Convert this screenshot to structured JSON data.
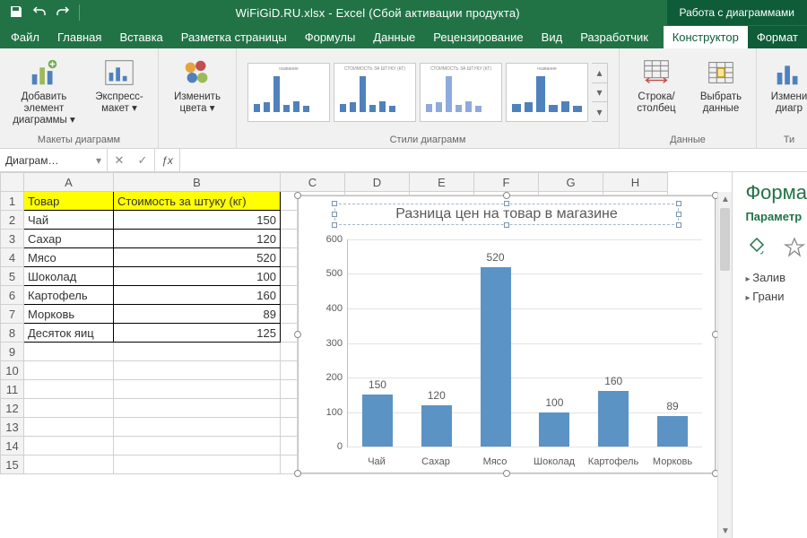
{
  "app": {
    "title": "WiFiGiD.RU.xlsx - Excel (Сбой активации продукта)",
    "contextual_tools": "Работа с диаграммами"
  },
  "tabs": {
    "file": "Файл",
    "home": "Главная",
    "insert": "Вставка",
    "layout": "Разметка страницы",
    "formulas": "Формулы",
    "data": "Данные",
    "review": "Рецензирование",
    "view": "Вид",
    "developer": "Разработчик",
    "ctx_design": "Конструктор",
    "ctx_format": "Формат"
  },
  "ribbon": {
    "add_element": "Добавить элемент диаграммы ▾",
    "quick_layout": "Экспресс-макет ▾",
    "change_colors": "Изменить цвета ▾",
    "group_layouts": "Макеты диаграмм",
    "group_styles": "Стили диаграмм",
    "switch_rowcol": "Строка/столбец",
    "select_data": "Выбрать данные",
    "group_data": "Данные",
    "change_type": "Измени\nдиагр",
    "group_type": "Ти"
  },
  "namebox": "Диаграм…",
  "sheet": {
    "col_headers": [
      "A",
      "B",
      "C",
      "D",
      "E",
      "F",
      "G",
      "H"
    ],
    "head_a": "Товар",
    "head_b": "Стоимость за штуку (кг)",
    "rows": [
      {
        "a": "Чай",
        "b": "150"
      },
      {
        "a": "Сахар",
        "b": "120"
      },
      {
        "a": "Мясо",
        "b": "520"
      },
      {
        "a": "Шоколад",
        "b": "100"
      },
      {
        "a": "Картофель",
        "b": "160"
      },
      {
        "a": "Морковь",
        "b": "89"
      },
      {
        "a": "Десяток яиц",
        "b": "125"
      }
    ]
  },
  "sidepane": {
    "title": "Форма",
    "subtitle": "Параметр",
    "fill": "Залив",
    "border": "Грани"
  },
  "chart_data": {
    "type": "bar",
    "title": "Разница цен на товар в магазине",
    "categories": [
      "Чай",
      "Сахар",
      "Мясо",
      "Шоколад",
      "Картофель",
      "Морковь"
    ],
    "values": [
      150,
      120,
      520,
      100,
      160,
      89
    ],
    "ylim": [
      0,
      600
    ],
    "ystep": 100,
    "xlabel": "",
    "ylabel": ""
  }
}
